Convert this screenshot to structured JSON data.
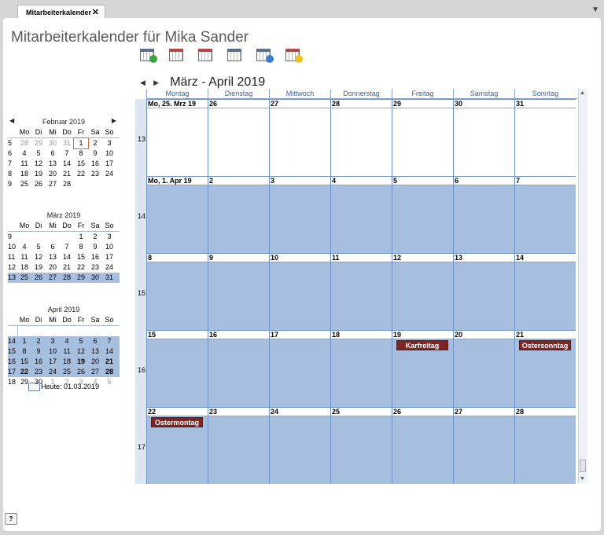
{
  "tab": {
    "label": "Mitarbeiterkalender",
    "close": "✕",
    "menu": "▼"
  },
  "page_title": "Mitarbeiterkalender für Mika Sander",
  "toolbar": {
    "buttons": [
      "add-appointment",
      "day-view",
      "week-view",
      "month-view",
      "list-view",
      "employee-view"
    ]
  },
  "month_nav": {
    "prev": "◀",
    "next": "▶",
    "title": "März - April 2019"
  },
  "weekday_headers": [
    "Montag",
    "Dienstag",
    "Mittwoch",
    "Donnerstag",
    "Freitag",
    "Samstag",
    "Sonntag"
  ],
  "weeks": [
    {
      "num": "13",
      "days": [
        "Mo, 25. Mrz 19",
        "26",
        "27",
        "28",
        "29",
        "30",
        "31"
      ]
    },
    {
      "num": "14",
      "days": [
        "Mo, 1. Apr 19",
        "2",
        "3",
        "4",
        "5",
        "6",
        "7"
      ]
    },
    {
      "num": "15",
      "days": [
        "8",
        "9",
        "10",
        "11",
        "12",
        "13",
        "14"
      ]
    },
    {
      "num": "16",
      "days": [
        "15",
        "16",
        "17",
        "18",
        "19",
        "20",
        "21"
      ]
    },
    {
      "num": "17",
      "days": [
        "22",
        "23",
        "24",
        "25",
        "26",
        "27",
        "28"
      ]
    }
  ],
  "events": {
    "karfreitag": "Karfreitag",
    "ostersonntag": "Ostersonntag",
    "ostermontag": "Ostermontag"
  },
  "mini": {
    "feb": {
      "title": "Februar 2019",
      "prev": "◀",
      "next": "▶"
    },
    "mar": {
      "title": "März 2019"
    },
    "apr": {
      "title": "April 2019"
    },
    "dow": [
      "Mo",
      "Di",
      "Mi",
      "Do",
      "Fr",
      "Sa",
      "So"
    ],
    "feb_rows": [
      {
        "wk": "5",
        "d": [
          "28",
          "29",
          "30",
          "31",
          "1",
          "2",
          "3"
        ]
      },
      {
        "wk": "6",
        "d": [
          "4",
          "5",
          "6",
          "7",
          "8",
          "9",
          "10"
        ]
      },
      {
        "wk": "7",
        "d": [
          "11",
          "12",
          "13",
          "14",
          "15",
          "16",
          "17"
        ]
      },
      {
        "wk": "8",
        "d": [
          "18",
          "19",
          "20",
          "21",
          "22",
          "23",
          "24"
        ]
      },
      {
        "wk": "9",
        "d": [
          "25",
          "26",
          "27",
          "28",
          "",
          "",
          ""
        ]
      }
    ],
    "mar_rows": [
      {
        "wk": "9",
        "d": [
          "",
          "",
          "",
          "",
          "1",
          "2",
          "3"
        ]
      },
      {
        "wk": "10",
        "d": [
          "4",
          "5",
          "6",
          "7",
          "8",
          "9",
          "10"
        ]
      },
      {
        "wk": "11",
        "d": [
          "11",
          "12",
          "13",
          "14",
          "15",
          "16",
          "17"
        ]
      },
      {
        "wk": "12",
        "d": [
          "18",
          "19",
          "20",
          "21",
          "22",
          "23",
          "24"
        ]
      },
      {
        "wk": "13",
        "d": [
          "25",
          "26",
          "27",
          "28",
          "29",
          "30",
          "31"
        ]
      }
    ],
    "apr_rows": [
      {
        "wk": "14",
        "d": [
          "1",
          "2",
          "3",
          "4",
          "5",
          "6",
          "7"
        ]
      },
      {
        "wk": "15",
        "d": [
          "8",
          "9",
          "10",
          "11",
          "12",
          "13",
          "14"
        ]
      },
      {
        "wk": "16",
        "d": [
          "15",
          "16",
          "17",
          "18",
          "19",
          "20",
          "21"
        ]
      },
      {
        "wk": "17",
        "d": [
          "22",
          "23",
          "24",
          "25",
          "26",
          "27",
          "28"
        ]
      },
      {
        "wk": "18",
        "d": [
          "29",
          "30",
          "1",
          "2",
          "3",
          "4",
          "5"
        ]
      }
    ]
  },
  "today_label": "Heute: 01.03.2019",
  "help": "?",
  "scroll": {
    "up": "▲",
    "down": "▼"
  }
}
